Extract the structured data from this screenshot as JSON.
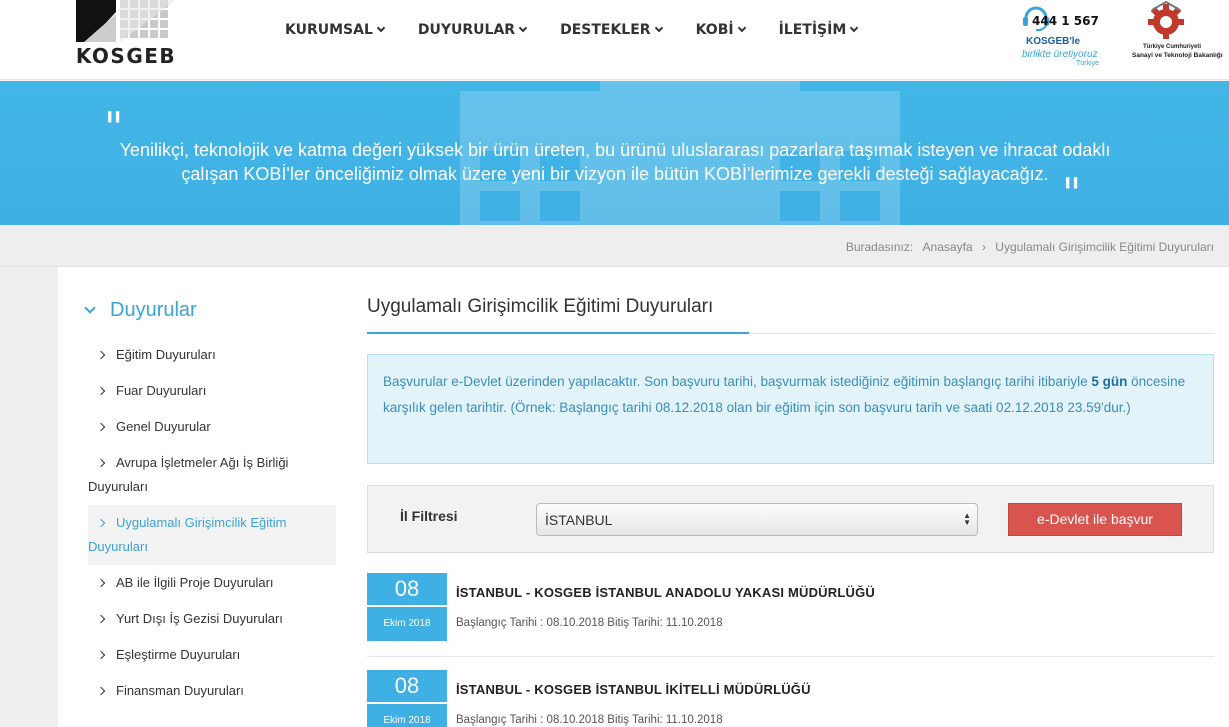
{
  "header": {
    "logo_text": "KOSGEB",
    "nav": [
      {
        "label": "KURUMSAL"
      },
      {
        "label": "DUYURULAR"
      },
      {
        "label": "DESTEKLER"
      },
      {
        "label": "KOBİ"
      },
      {
        "label": "İLETİŞİM"
      }
    ],
    "hotline": {
      "phone": "444 1 567",
      "brand": "KOSGEB'le",
      "slogan": "birlikte üretiyoruz",
      "country": "Türkiye"
    },
    "ministry": {
      "line1": "Türkiye Cumhuriyeti",
      "line2": "Sanayi ve Teknoloji Bakanlığı"
    }
  },
  "hero": {
    "quote_open": "\"",
    "quote_close": "\"",
    "text": "Yenilikçi, teknolojik ve katma değeri yüksek bir ürün üreten, bu ürünü uluslararası pazarlara taşımak isteyen ve ihracat odaklı çalışan KOBİ'ler önceliğimiz olmak üzere yeni bir vizyon ile bütün KOBİ'lerimize gerekli desteği sağlayacağız."
  },
  "breadcrumb": {
    "prefix": "Buradasınız:",
    "home": "Anasayfa",
    "separator": "›",
    "current": "Uygulamalı Girişimcilik Eğitimi Duyuruları"
  },
  "sidebar": {
    "title": "Duyurular",
    "items": [
      {
        "label": "Eğitim Duyuruları"
      },
      {
        "label": "Fuar Duyuruları"
      },
      {
        "label": "Genel Duyurular"
      },
      {
        "label": "Avrupa İşletmeler Ağı İş Birliği Duyuruları"
      },
      {
        "label": "Uygulamalı Girişimcilik Eğitim Duyuruları"
      },
      {
        "label": "AB ile İlgili Proje Duyuruları"
      },
      {
        "label": "Yurt Dışı İş Gezisi Duyuruları"
      },
      {
        "label": "Eşleştirme Duyuruları"
      },
      {
        "label": "Finansman Duyuruları"
      }
    ]
  },
  "main": {
    "title": "Uygulamalı Girişimcilik Eğitimi Duyuruları",
    "info": {
      "part1": "Başvurular e-Devlet üzerinden yapılacaktır. Son başvuru tarihi, başvurmak istediğiniz eğitimin başlangıç tarihi itibariyle ",
      "bold": "5 gün",
      "part2": " öncesine karşılık gelen tarihtir. (Örnek: Başlangıç tarihi 08.12.2018 olan bir eğitim için son başvuru tarih ve saati 02.12.2018 23.59'dur.)"
    },
    "filter": {
      "label": "İl Filtresi",
      "selected": "İSTANBUL",
      "button": "e-Devlet ile başvur"
    },
    "announcements": [
      {
        "day": "08",
        "month": "Ekim 2018",
        "title": "İSTANBUL - KOSGEB İSTANBUL ANADOLU YAKASI MÜDÜRLÜĞÜ",
        "dates": "Başlangıç Tarihi : 08.10.2018 Bitiş Tarihi: 11.10.2018"
      },
      {
        "day": "08",
        "month": "Ekim 2018",
        "title": "İSTANBUL - KOSGEB İSTANBUL İKİTELLİ MÜDÜRLÜĞÜ",
        "dates": "Başlangıç Tarihi : 08.10.2018 Bitiş Tarihi: 11.10.2018"
      }
    ]
  },
  "colors": {
    "accent": "#3fb0e4",
    "button_red": "#d9534f",
    "info_bg": "#e3f3fa"
  },
  "icons": {
    "chevron": "chevron-down-icon",
    "arrow": "chevron-right-icon",
    "headset": "headset-icon",
    "gear": "gear-icon"
  }
}
